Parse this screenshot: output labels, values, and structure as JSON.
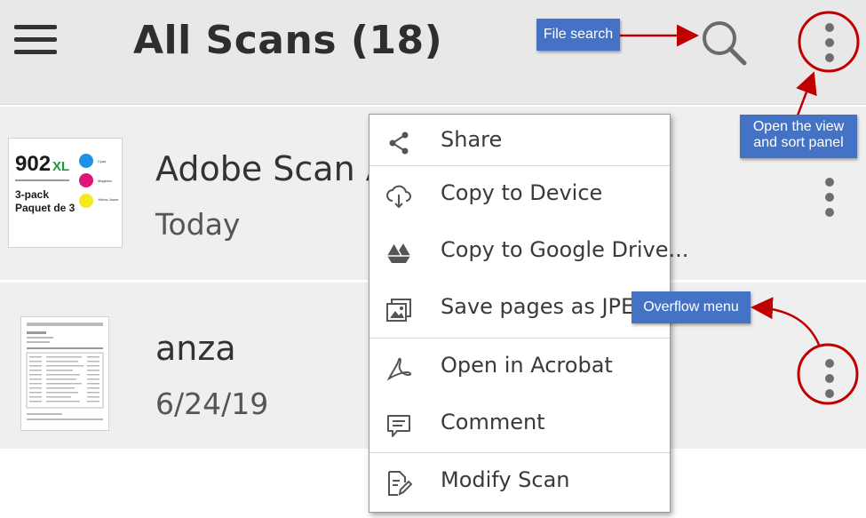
{
  "appbar": {
    "menu_icon": "hamburger-menu-icon",
    "title": "All Scans (18)",
    "search_icon": "search-icon",
    "overflow_icon": "vertical-dots-icon"
  },
  "scans": [
    {
      "name": "Adobe Scan A",
      "date": "Today",
      "thumbnail": {
        "brand": "902",
        "brand_suffix": "XL",
        "line1": "3-pack",
        "line2": "Paquet de 3",
        "inks": [
          {
            "label": "Cyan",
            "color": "#1e90e6"
          },
          {
            "label": "Magenta",
            "color": "#e0157a"
          },
          {
            "label": "Yellow Jaune",
            "color": "#f5e81c"
          }
        ]
      }
    },
    {
      "name": "anza",
      "date": "6/24/19",
      "thumbnail": {
        "kind": "document-page"
      }
    }
  ],
  "context_menu": {
    "items": [
      {
        "label": "Share",
        "icon": "share-icon"
      },
      {
        "label": "Copy to Device",
        "icon": "cloud-download-icon"
      },
      {
        "label": "Copy to Google Drive...",
        "icon": "google-drive-icon"
      },
      {
        "label": "Save pages as JPEG",
        "icon": "image-icon"
      },
      {
        "label": "Open in Acrobat",
        "icon": "acrobat-icon"
      },
      {
        "label": "Comment",
        "icon": "comment-icon"
      },
      {
        "label": "Modify Scan",
        "icon": "edit-document-icon"
      }
    ]
  },
  "annotations": {
    "file_search": "File search",
    "view_sort_line1": "Open the view",
    "view_sort_line2": "and sort panel",
    "overflow_menu": "Overflow menu"
  },
  "colors": {
    "callout_bg": "#4472c4",
    "annotation_red": "#c00000",
    "appbar_bg": "#e8e8e8",
    "row_bg": "#efefef"
  }
}
